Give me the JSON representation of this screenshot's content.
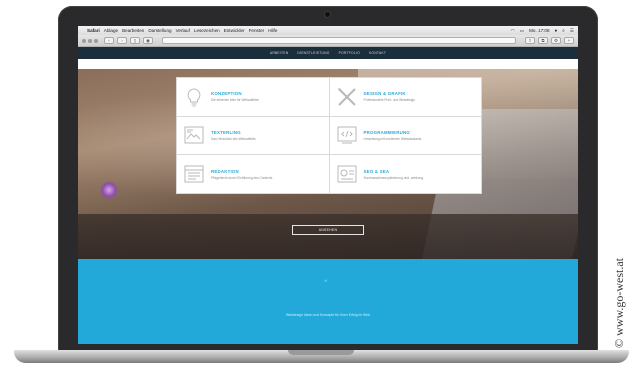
{
  "menubar": {
    "app": "Safari",
    "items": [
      "Ablage",
      "Bearbeiten",
      "Darstellung",
      "Verlauf",
      "Lesezeichen",
      "Entwickler",
      "Fenster",
      "Hilfe"
    ],
    "clock": "Mo. 17:08"
  },
  "browser": {
    "url": ""
  },
  "site": {
    "nav": [
      "ARBEITEN",
      "DIENSTLEISTUNG",
      "PORTFOLIO",
      "KONTAKT"
    ],
    "services": [
      {
        "title": "KONZEPTION",
        "sub": "Die fehlende Idee für Webauftritte",
        "icon": "lightbulb-icon"
      },
      {
        "title": "DESIGN & GRAFIK",
        "sub": "Professionelle Print- und Webdesign",
        "icon": "pencil-ruler-icon"
      },
      {
        "title": "TEXTERLING",
        "sub": "Das Herzstück des Webauftritts",
        "icon": "text-image-icon"
      },
      {
        "title": "PROGRAMMIERUNG",
        "sub": "Umsetzung mit modernen Webstandards",
        "icon": "code-icon"
      },
      {
        "title": "REDAKTION",
        "sub": "Pflegeleicht durch Einführung des Contents",
        "icon": "layout-icon"
      },
      {
        "title": "SEO & SEA",
        "sub": "Suchmaschinenoptimierung und -werbung",
        "icon": "analytics-icon"
      }
    ],
    "button": "ANSEHEN",
    "footer_text": "Webdesign Ideen und Konzepte für Ihren Erfolg im Web"
  },
  "watermark": "© www.go-west.at",
  "colors": {
    "accent": "#23a9d9",
    "nav": "#1b2e3c"
  }
}
